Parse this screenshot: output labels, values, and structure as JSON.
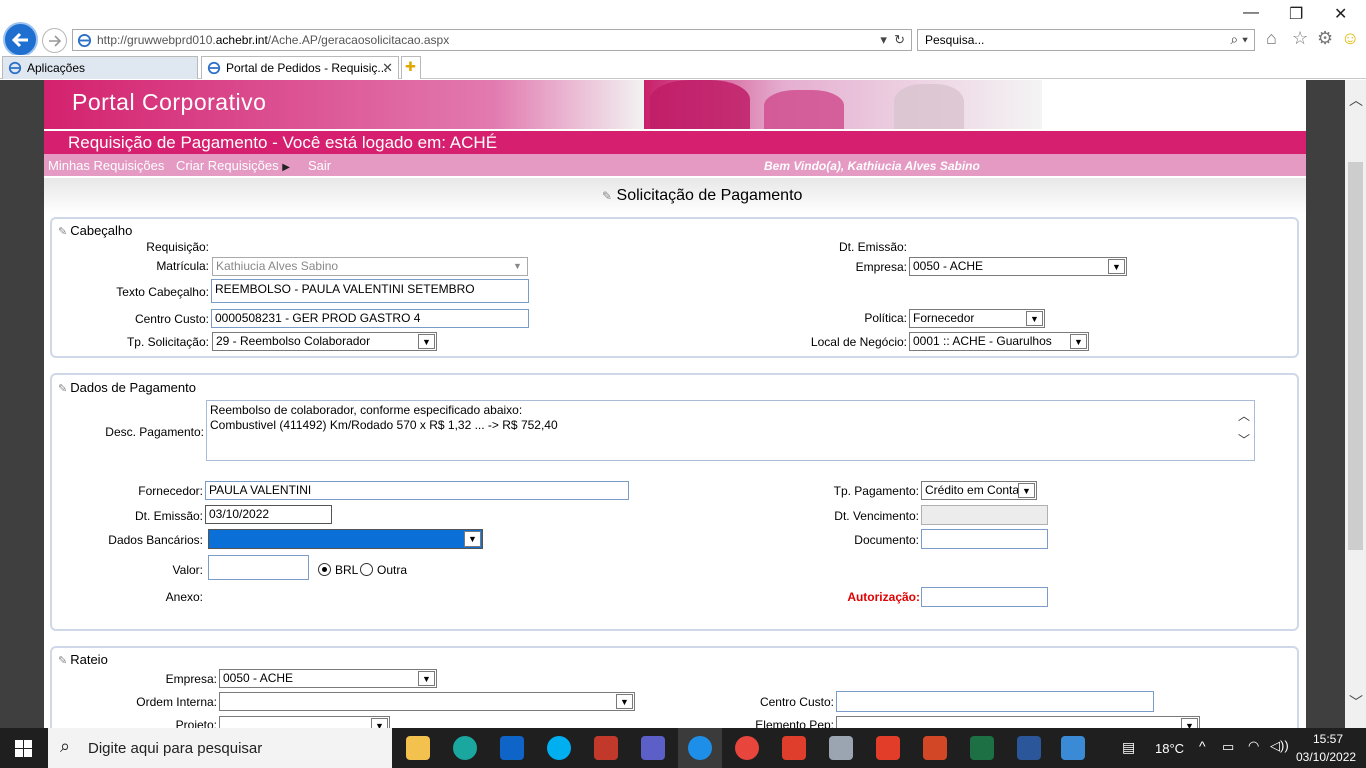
{
  "browser": {
    "url_prefix": "http://gruwwebprd010.",
    "url_host": "achebr.int",
    "url_path": "/Ache.AP/geracaosolicitacao.aspx",
    "search_placeholder": "Pesquisa...",
    "tabs": [
      {
        "label": "Aplicações"
      },
      {
        "label": "Portal de Pedidos - Requisiç..."
      }
    ]
  },
  "portal": {
    "title": "Portal Corporativo",
    "header": "Requisição de Pagamento - Você está logado em: ACHÉ",
    "menu": {
      "minhas": "Minhas Requisições",
      "criar": "Criar Requisições",
      "sair": "Sair"
    },
    "welcome": "Bem Vindo(a), Kathiucia Alves Sabino",
    "page_title": "Solicitação de Pagamento"
  },
  "cabecalho": {
    "title": "Cabeçalho",
    "requisicao_label": "Requisição:",
    "matricula_label": "Matrícula:",
    "matricula_value": "Kathiucia Alves Sabino",
    "texto_label": "Texto Cabeçalho:",
    "texto_value": "REEMBOLSO - PAULA VALENTINI SETEMBRO",
    "centro_label": "Centro Custo:",
    "centro_value": "0000508231 - GER PROD GASTRO 4",
    "tp_solic_label": "Tp. Solicitação:",
    "tp_solic_value": "29 - Reembolso Colaborador",
    "dt_emissao_label": "Dt. Emissão:",
    "empresa_label": "Empresa:",
    "empresa_value": "0050 - ACHE",
    "politica_label": "Política:",
    "politica_value": "Fornecedor",
    "local_label": "Local de Negócio:",
    "local_value": "0001 :: ACHE - Guarulhos"
  },
  "pagamento": {
    "title": "Dados de Pagamento",
    "desc_label": "Desc. Pagamento:",
    "desc_line1": "Reembolso de colaborador, conforme especificado abaixo:",
    "desc_line2": "Combustivel (411492) Km/Rodado 570 x R$ 1,32 ... -> R$  752,40",
    "fornecedor_label": "Fornecedor:",
    "fornecedor_value": "PAULA VALENTINI",
    "dt_emissao_label": "Dt. Emissão:",
    "dt_emissao_value": "03/10/2022",
    "bancarios_label": "Dados Bancários:",
    "valor_label": "Valor:",
    "brl_label": "BRL",
    "outra_label": "Outra",
    "anexo_label": "Anexo:",
    "tp_pag_label": "Tp. Pagamento:",
    "tp_pag_value": "Crédito em Conta",
    "dt_venc_label": "Dt. Vencimento:",
    "documento_label": "Documento:",
    "autorizacao_label": "Autorização:",
    "autorizacao_color": "#e00000"
  },
  "rateio": {
    "title": "Rateio",
    "empresa_label": "Empresa:",
    "empresa_value": "0050 - ACHE",
    "ordem_label": "Ordem Interna:",
    "projeto_label": "Projeto:",
    "centro_label": "Centro Custo:",
    "elemento_label": "Elemento Pep:"
  },
  "taskbar": {
    "search_placeholder": "Digite aqui para pesquisar",
    "temperature": "18°C",
    "time": "15:57",
    "date": "03/10/2022"
  }
}
